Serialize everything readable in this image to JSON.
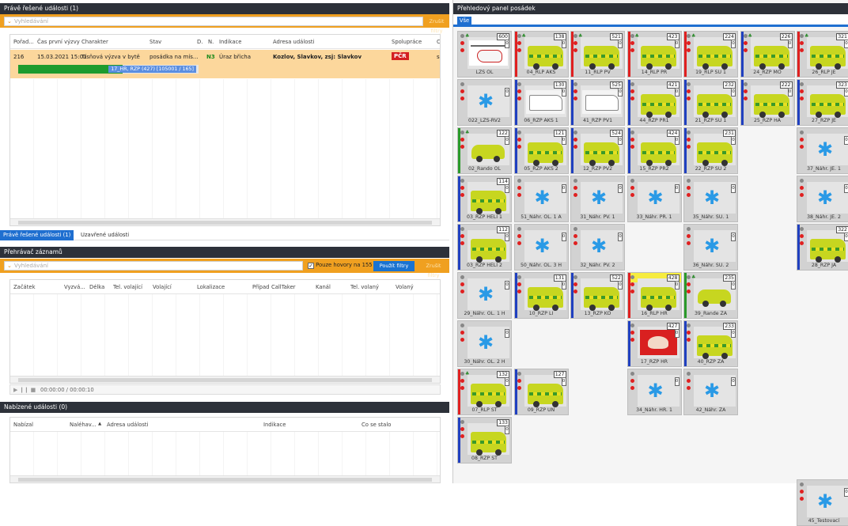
{
  "left": {
    "events_title": "Právě řešené události (1)",
    "events_search_placeholder": "Vyhledávání",
    "events_clear": "Zrušit filtry",
    "events_columns": [
      "Pořad...",
      "Čas první výzvy",
      "Charakter",
      "Stav",
      "D.",
      "N.",
      "Indikace",
      "Adresa události",
      "Spolupráce",
      "Ca"
    ],
    "event_row": {
      "order": "216",
      "time": "15.03.2021 15:01",
      "character": "Tísňová výzva v bytě",
      "state": "posádka na mís...",
      "d": "",
      "n": "N3",
      "indication": "Úraz břicha",
      "address": "Kozlov, Slavkov, zsj: Slavkov",
      "coop": "PČR",
      "ca": "sp"
    },
    "event_progress": "17_HR, RZP (427) [105001 / 165]",
    "event_progress_fraction": 0.58,
    "tabs": [
      "Právě řešené události (1)",
      "Uzavřené události"
    ],
    "player_title": "Přehrávač záznamů",
    "player_search_placeholder": "Vyhledávání",
    "player_checkbox_label": "Pouze hovory na 155",
    "player_apply": "Použít filtry",
    "player_clear": "Zrušit filtry",
    "player_columns": [
      "Začátek",
      "Vyzvá...",
      "Délka",
      "Tel. volající",
      "Volající",
      "Lokalizace",
      "Případ",
      "CallTaker",
      "Kanál",
      "Tel. volaný",
      "Volaný"
    ],
    "player_time": "00:00:00 / 00:00:10",
    "player_controls": "▶ ❙❙ ■",
    "offered_title": "Nabízené události (0)",
    "offered_columns": [
      "Nabízal",
      "Naléhav...",
      "▲",
      "Adresa události",
      "Indikace",
      "Co se stalo"
    ]
  },
  "right": {
    "title": "Přehledový panel posádek",
    "tab_all": "Vše",
    "colors": {
      "red": "#e02020",
      "blue": "#2040c0",
      "green": "#2a9a2a",
      "yellow": "#f0e020",
      "grey": "#888888"
    },
    "units": [
      {
        "id": "LZS OL",
        "num": "600",
        "type": "heli",
        "bar": "",
        "dots": [
          "grey",
          "red",
          "red"
        ],
        "g": true
      },
      {
        "id": "04_RLP AKS",
        "num": "138",
        "type": "amb",
        "bar": "red",
        "dots": [
          "grey",
          "red",
          "red"
        ],
        "g": true
      },
      {
        "id": "11_RLP PV",
        "num": "521",
        "type": "amb",
        "bar": "red",
        "dots": [
          "grey",
          "red",
          "red"
        ],
        "g": true
      },
      {
        "id": "14_RLP PR",
        "num": "423",
        "type": "amb",
        "bar": "red",
        "dots": [
          "grey",
          "red",
          "red"
        ],
        "g": true
      },
      {
        "id": "19_RLP SU 1",
        "num": "224",
        "type": "amb",
        "bar": "red",
        "dots": [
          "grey",
          "red",
          "red"
        ],
        "g": true
      },
      {
        "id": "24_RZP MO",
        "num": "226",
        "type": "amb",
        "bar": "blue",
        "dots": [
          "grey",
          "red",
          "red"
        ],
        "g": true
      },
      {
        "id": "26_RLP JE",
        "num": "321",
        "type": "amb",
        "bar": "red",
        "dots": [
          "grey",
          "red",
          "red"
        ],
        "g": true
      },
      {
        "id": "022_LZS-RV2",
        "num": "",
        "type": "star",
        "bar": "",
        "dots": [
          "grey",
          "red",
          "red"
        ],
        "g": false
      },
      {
        "id": "06_RZP AKS 1",
        "num": "130",
        "type": "van",
        "bar": "blue",
        "dots": [
          "grey",
          "red",
          "red"
        ],
        "g": false
      },
      {
        "id": "41_RZP PV1",
        "num": "525",
        "type": "van",
        "bar": "blue",
        "dots": [
          "grey",
          "red",
          "red"
        ],
        "g": false
      },
      {
        "id": "44_RZP PR1",
        "num": "421",
        "type": "amb",
        "bar": "blue",
        "dots": [
          "grey",
          "red",
          "red"
        ],
        "g": false
      },
      {
        "id": "21_RZP SU 1",
        "num": "232",
        "type": "amb",
        "bar": "blue",
        "dots": [
          "grey",
          "red",
          "red"
        ],
        "g": false
      },
      {
        "id": "25_RZP HA",
        "num": "222",
        "type": "amb",
        "bar": "blue",
        "dots": [
          "grey",
          "red",
          "red"
        ],
        "g": false
      },
      {
        "id": "27_RZP JE",
        "num": "323",
        "type": "amb",
        "bar": "blue",
        "dots": [
          "grey",
          "red",
          "red"
        ],
        "g": false
      },
      {
        "id": "02_Rando OL",
        "num": "122",
        "type": "car",
        "bar": "green",
        "dots": [
          "grey",
          "red",
          "red"
        ],
        "g": true
      },
      {
        "id": "05_RZP AKS 2",
        "num": "121",
        "type": "amb",
        "bar": "blue",
        "dots": [
          "grey",
          "red",
          "red"
        ],
        "g": false
      },
      {
        "id": "12_RZP PV2",
        "num": "524",
        "type": "amb",
        "bar": "blue",
        "dots": [
          "grey",
          "red",
          "red"
        ],
        "g": false
      },
      {
        "id": "15_RZP PR2",
        "num": "424",
        "type": "amb",
        "bar": "blue",
        "dots": [
          "grey",
          "red",
          "red"
        ],
        "g": false
      },
      {
        "id": "22_RZP SU 2",
        "num": "231",
        "type": "amb",
        "bar": "blue",
        "dots": [
          "grey",
          "red",
          "red"
        ],
        "g": false
      },
      {
        "id": "37_Náhr. JE. 1",
        "num": "",
        "type": "star",
        "bar": "",
        "dots": [
          "grey",
          "red",
          "red"
        ],
        "g": false
      },
      {
        "id": "03_RZP HELI 1",
        "num": "114",
        "type": "amb",
        "bar": "blue",
        "dots": [
          "grey",
          "red",
          "red"
        ],
        "g": false
      },
      {
        "id": "51_Náhr. OL. 1 A",
        "num": "",
        "type": "star",
        "bar": "",
        "dots": [
          "grey",
          "red",
          "red"
        ],
        "g": false
      },
      {
        "id": "31_Náhr. PV. 1",
        "num": "",
        "type": "star",
        "bar": "",
        "dots": [
          "grey",
          "red",
          "red"
        ],
        "g": false
      },
      {
        "id": "33_Náhr. PR. 1",
        "num": "",
        "type": "star",
        "bar": "",
        "dots": [
          "grey",
          "red",
          "red"
        ],
        "g": false
      },
      {
        "id": "35_Náhr. SU. 1",
        "num": "",
        "type": "star",
        "bar": "",
        "dots": [
          "grey",
          "red",
          "red"
        ],
        "g": false
      },
      {
        "id": "38_Náhr. JE. 2",
        "num": "",
        "type": "star",
        "bar": "",
        "dots": [
          "grey",
          "red",
          "red"
        ],
        "g": false
      },
      {
        "id": "03_RZP HELI 2",
        "num": "112",
        "type": "amb",
        "bar": "blue",
        "dots": [
          "grey",
          "red",
          "red"
        ],
        "g": false
      },
      {
        "id": "50_Náhr. OL. 3 H",
        "num": "",
        "type": "star",
        "bar": "",
        "dots": [
          "grey",
          "red",
          "red"
        ],
        "g": false
      },
      {
        "id": "32_Náhr. PV. 2",
        "num": "",
        "type": "star",
        "bar": "",
        "dots": [
          "grey",
          "red",
          "red"
        ],
        "g": false
      },
      {
        "id": "36_Náhr. SU. 2",
        "num": "",
        "type": "star",
        "bar": "",
        "dots": [
          "grey",
          "red",
          "red"
        ],
        "g": false
      },
      {
        "id": "28_RZP JA",
        "num": "322",
        "type": "amb",
        "bar": "blue",
        "dots": [
          "grey",
          "red",
          "red"
        ],
        "g": false
      },
      {
        "id": "29_Náhr. OL. 1 H",
        "num": "",
        "type": "star",
        "bar": "",
        "dots": [
          "grey",
          "red",
          "red"
        ],
        "g": false
      },
      {
        "id": "10_RZP LI",
        "num": "131",
        "type": "amb",
        "bar": "blue",
        "dots": [
          "grey",
          "red",
          "red"
        ],
        "g": false
      },
      {
        "id": "13_RZP KO",
        "num": "522",
        "type": "amb",
        "bar": "blue",
        "dots": [
          "grey",
          "red",
          "red"
        ],
        "g": false
      },
      {
        "id": "16_RLP HR",
        "num": "428",
        "type": "amb",
        "bar": "red",
        "dots": [
          "grey",
          "red",
          "red"
        ],
        "g": false,
        "top": "yellow"
      },
      {
        "id": "39_Rande ZA",
        "num": "235",
        "type": "car",
        "bar": "green",
        "dots": [
          "grey",
          "red",
          "red"
        ],
        "g": true
      },
      {
        "id": "30_Náhr. OL. 2 H",
        "num": "",
        "type": "star",
        "bar": "",
        "dots": [
          "grey",
          "red",
          "red"
        ],
        "g": false
      },
      {
        "id": "17_RZP HR",
        "num": "427",
        "type": "person",
        "bar": "blue",
        "dots": [
          "grey",
          "red",
          "red"
        ],
        "g": false
      },
      {
        "id": "40_RZP ZA",
        "num": "233",
        "type": "amb",
        "bar": "blue",
        "dots": [
          "grey",
          "red",
          "red"
        ],
        "g": false
      },
      {
        "id": "07_RLP ST",
        "num": "132",
        "type": "amb",
        "bar": "red",
        "dots": [
          "grey",
          "red",
          "red"
        ],
        "g": true
      },
      {
        "id": "09_RZP UN",
        "num": "127",
        "type": "amb",
        "bar": "blue",
        "dots": [
          "grey",
          "red",
          "red"
        ],
        "g": false
      },
      {
        "id": "34_Náhr. HR. 1",
        "num": "",
        "type": "star",
        "bar": "",
        "dots": [
          "grey",
          "red",
          "red"
        ],
        "g": false
      },
      {
        "id": "42_Náhr. ZA",
        "num": "",
        "type": "star",
        "bar": "",
        "dots": [
          "grey",
          "red",
          "red"
        ],
        "g": false
      },
      {
        "id": "08_RZP ST",
        "num": "133",
        "type": "amb",
        "bar": "blue",
        "dots": [
          "grey",
          "red",
          "red"
        ],
        "g": false
      },
      {
        "id": "45_Testovací",
        "num": "",
        "type": "star",
        "bar": "",
        "dots": [
          "grey",
          "red",
          "red"
        ],
        "g": false
      }
    ]
  }
}
